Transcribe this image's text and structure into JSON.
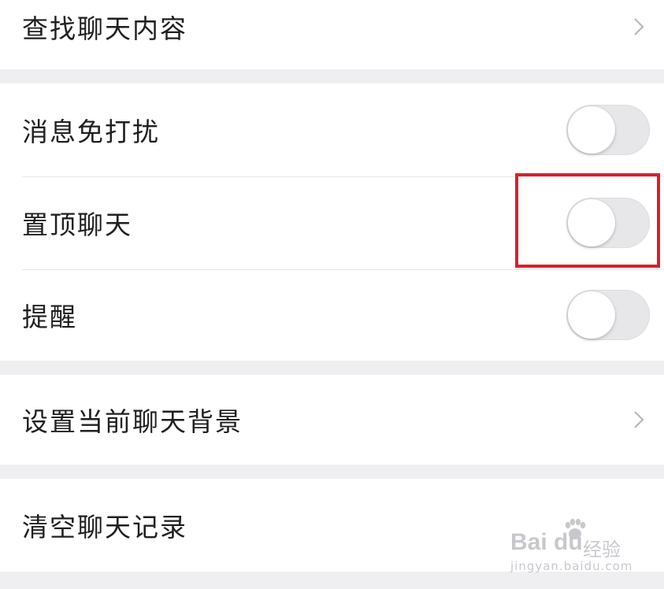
{
  "sections": {
    "search": {
      "label": "查找聊天内容"
    },
    "notifications": {
      "mute_label": "消息免打扰",
      "mute_on": false,
      "pin_label": "置顶聊天",
      "pin_on": false,
      "remind_label": "提醒",
      "remind_on": false
    },
    "background": {
      "label": "设置当前聊天背景"
    },
    "clear": {
      "label": "清空聊天记录"
    }
  },
  "icons": {
    "row_arrow": "chevron-right-icon"
  },
  "watermark": {
    "brand": "Bai  du",
    "jingyan": "经验",
    "url": "jingyan.baidu.com"
  },
  "colors": {
    "background": "#efeff2",
    "card": "#ffffff",
    "text": "#1f1f1f",
    "toggle_off": "#e7e7e9",
    "highlight": "#d8202a"
  }
}
